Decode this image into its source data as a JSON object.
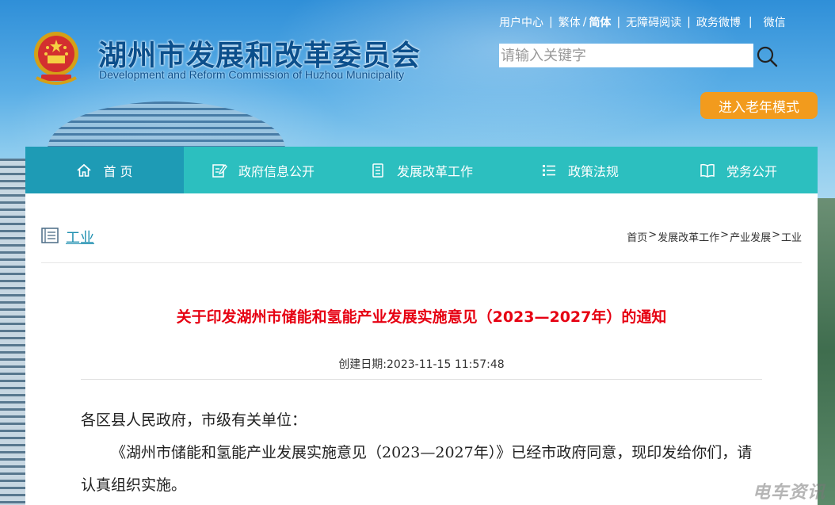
{
  "site": {
    "title_cn": "湖州市发展和改革委员会",
    "title_en": "Development and Reform Commission of Huzhou Municipality"
  },
  "top_links": {
    "user_center": "用户中心",
    "traditional": "繁体",
    "slash": "/",
    "simplified": "简体",
    "accessible": "无障碍阅读",
    "weibo": "政务微博",
    "wechat": "微信",
    "separator": "|"
  },
  "search": {
    "placeholder": "请输入关键字",
    "icon": "search-icon"
  },
  "elder_mode_label": "进入老年模式",
  "nav": {
    "items": [
      {
        "label": "首 页",
        "icon": "home-icon"
      },
      {
        "label": "政府信息公开",
        "icon": "edit-icon"
      },
      {
        "label": "发展改革工作",
        "icon": "list-icon"
      },
      {
        "label": "政策法规",
        "icon": "grid-list-icon"
      },
      {
        "label": "党务公开",
        "icon": "book-icon"
      }
    ]
  },
  "section": {
    "name": "工业",
    "icon": "document-list-icon"
  },
  "breadcrumb": {
    "items": [
      "首页",
      "发展改革工作",
      "产业发展",
      "工业"
    ],
    "separator": ">"
  },
  "article": {
    "title": "关于印发湖州市储能和氢能产业发展实施意见（2023—2027年）的通知",
    "date": "创建日期:2023-11-15 11:57:48",
    "salutation": "各区县人民政府，市级有关单位：",
    "paragraph": "《湖州市储能和氢能产业发展实施意见（2023—2027年）》已经市政府同意，现印发给你们，请认真组织实施。"
  },
  "watermark": "电车资讯",
  "colors": {
    "nav_bg": "#2cbfbf",
    "nav_active": "#1e9bb5",
    "title_red": "#e60012",
    "elder_orange": "#f29b1d",
    "title_blue": "#0b4f8c"
  }
}
